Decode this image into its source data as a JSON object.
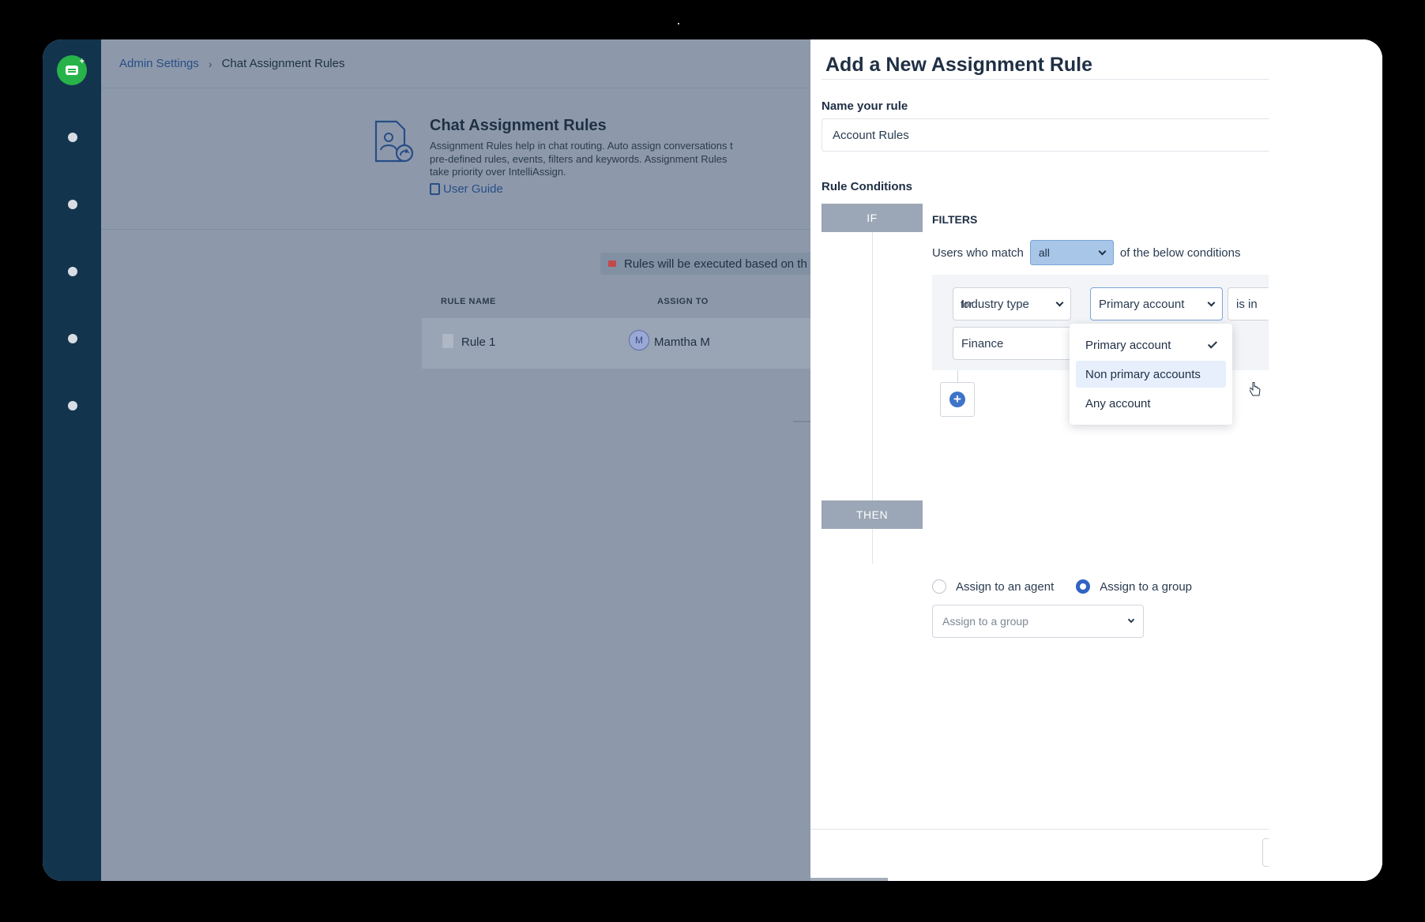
{
  "breadcrumb": {
    "parent": "Admin Settings",
    "current": "Chat Assignment Rules"
  },
  "intro": {
    "title": "Chat Assignment Rules",
    "description_lines": [
      "Assignment Rules help in chat routing. Auto assign conversations t",
      "pre-defined rules, events, filters and keywords. Assignment Rules",
      "take priority over IntelliAssign."
    ],
    "guide_link": "User Guide"
  },
  "notice": "Rules will be executed based on th",
  "table": {
    "headers": [
      "RULE NAME",
      "ASSIGN TO"
    ],
    "rows": [
      {
        "name": "Rule 1",
        "avatar_letter": "M",
        "agent": "Mamtha M"
      }
    ]
  },
  "panel": {
    "title": "Add a New Assignment Rule",
    "name_label": "Name your rule",
    "name_value": "Account Rules",
    "conditions_label": "Rule Conditions",
    "if_label": "IF",
    "then_label": "THEN",
    "filters_title": "FILTERS",
    "match_prefix": "Users who match",
    "match_value": "all",
    "match_suffix": "of the below conditions",
    "condition": {
      "field": "Industry type",
      "for_label": "for",
      "scope": "Primary account",
      "operator": "is in",
      "value": "Finance"
    },
    "scope_options": [
      {
        "label": "Primary account",
        "selected": true
      },
      {
        "label": "Non primary accounts",
        "hovered": true
      },
      {
        "label": "Any account"
      }
    ],
    "assign": {
      "agent_label": "Assign to an agent",
      "group_label": "Assign to a group",
      "selected": "group",
      "group_placeholder": "Assign to a group"
    }
  },
  "colors": {
    "sidebar": "#13344d",
    "accent": "#2f63c4",
    "brand": "#27b34a"
  }
}
